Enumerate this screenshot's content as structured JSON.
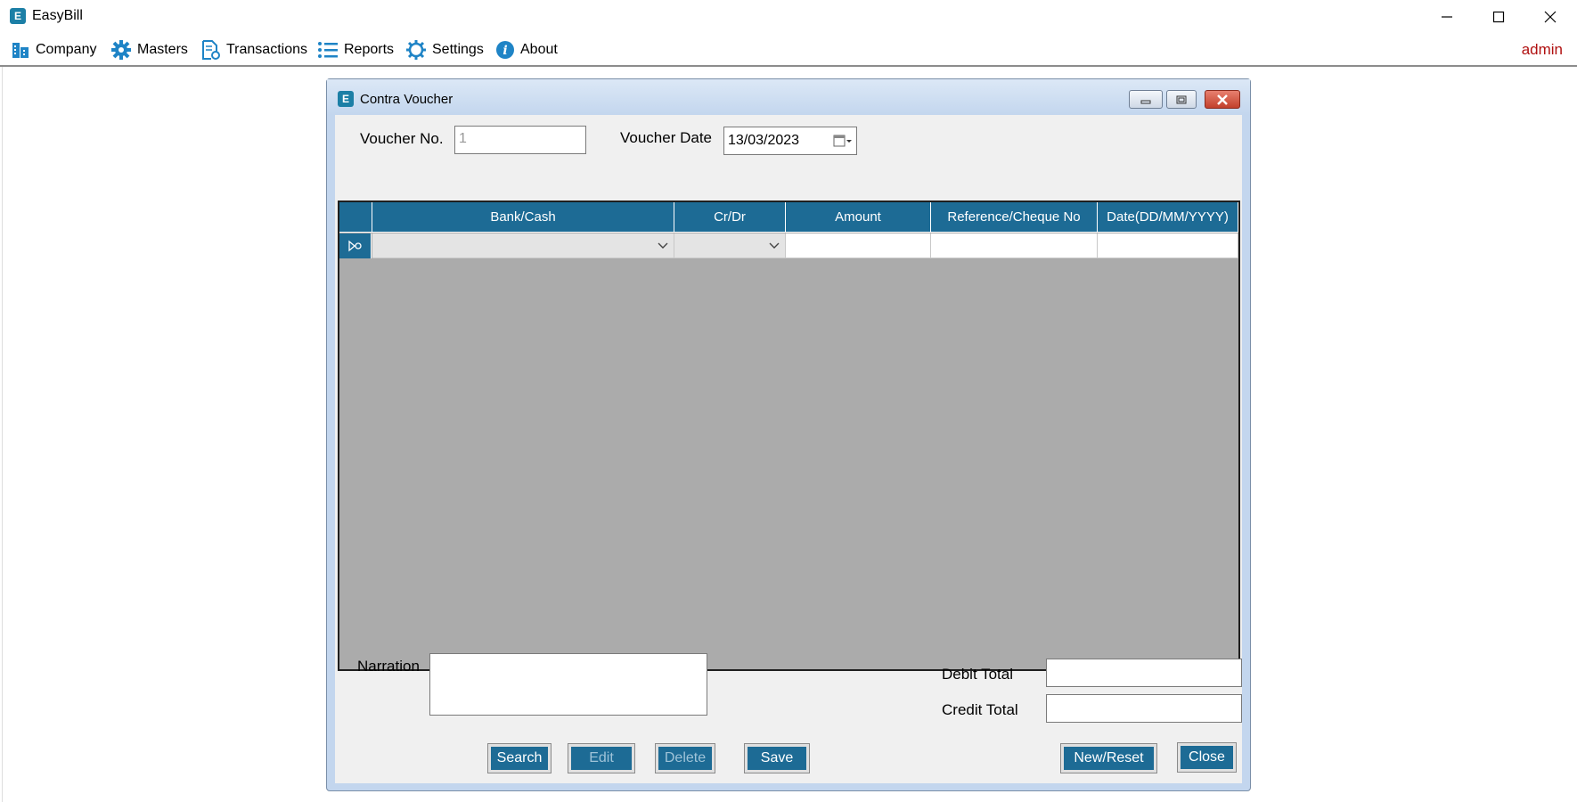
{
  "app": {
    "title": "EasyBill",
    "icon_letter": "E"
  },
  "window_controls": [
    "minimize-icon",
    "maximize-icon",
    "close-icon"
  ],
  "menu": [
    {
      "label": "Company",
      "icon": "building-icon"
    },
    {
      "label": "Masters",
      "icon": "gear-icon"
    },
    {
      "label": "Transactions",
      "icon": "document-gear-icon"
    },
    {
      "label": "Reports",
      "icon": "list-icon"
    },
    {
      "label": "Settings",
      "icon": "settings-cog-icon"
    },
    {
      "label": "About",
      "icon": "info-icon"
    }
  ],
  "user": "admin",
  "form": {
    "title": "Contra Voucher",
    "icon_letter": "E",
    "voucher_no_label": "Voucher No.",
    "voucher_no_value": "1",
    "voucher_date_label": "Voucher Date",
    "voucher_date_value": "13/03/2023",
    "grid": {
      "columns": [
        "Bank/Cash",
        "Cr/Dr",
        "Amount",
        "Reference/Cheque No",
        "Date(DD/MM/YYYY)"
      ],
      "rows": [
        {
          "bank_cash": "",
          "cr_dr": "",
          "amount": "",
          "reference": "",
          "date": ""
        }
      ]
    },
    "narration_label": "Narration",
    "narration_value": "",
    "debit_total_label": "Debit Total",
    "debit_total_value": "",
    "credit_total_label": "Credit Total",
    "credit_total_value": "",
    "buttons": {
      "search": "Search",
      "edit": "Edit",
      "delete": "Delete",
      "save": "Save",
      "new_reset": "New/Reset",
      "close": "Close"
    }
  },
  "colors": {
    "accent": "#1d6b95",
    "admin_text": "#b01010",
    "grid_bg": "#ababab"
  }
}
